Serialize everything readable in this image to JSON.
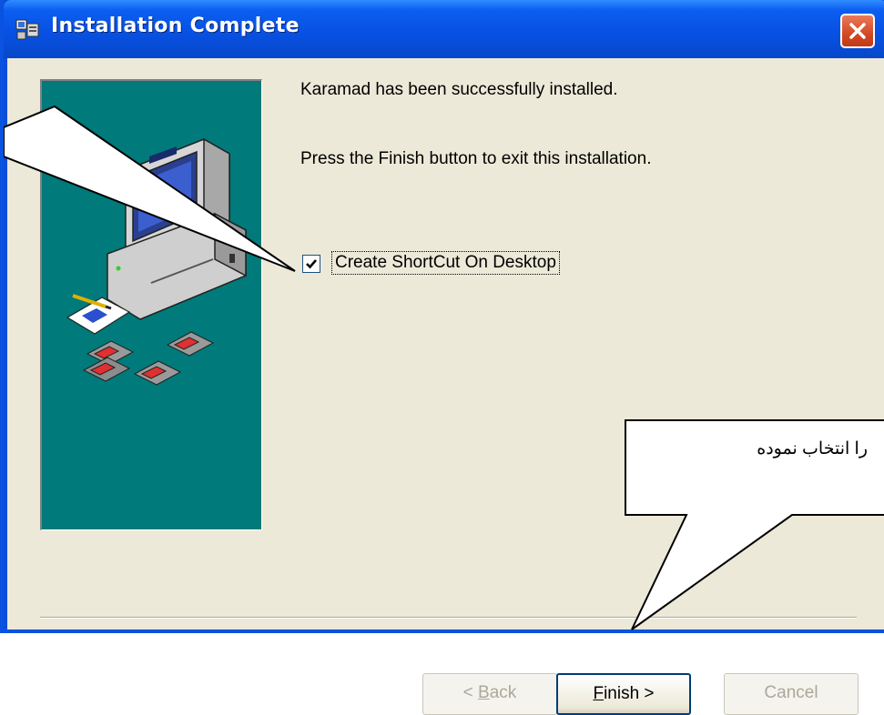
{
  "window": {
    "title": "Installation Complete",
    "icon": "installer-icon",
    "close_icon": "close-icon"
  },
  "content": {
    "message_installed": "Karamad has been successfully installed.",
    "message_finish": "Press the Finish button to exit this installation.",
    "shortcut_checkbox": {
      "label": "Create ShortCut On Desktop",
      "checked": true
    }
  },
  "buttons": {
    "back": {
      "label": "< Back",
      "enabled": false
    },
    "finish": {
      "label": "Finish >",
      "enabled": true
    },
    "cancel": {
      "label": "Cancel",
      "enabled": false
    }
  },
  "annotation": {
    "callout_text": "را انتخاب نموده"
  },
  "colors": {
    "title_bar": "#0851e4",
    "dialog_background": "#ece9d8",
    "side_panel": "#007a7a",
    "close_button": "#d24a24"
  }
}
